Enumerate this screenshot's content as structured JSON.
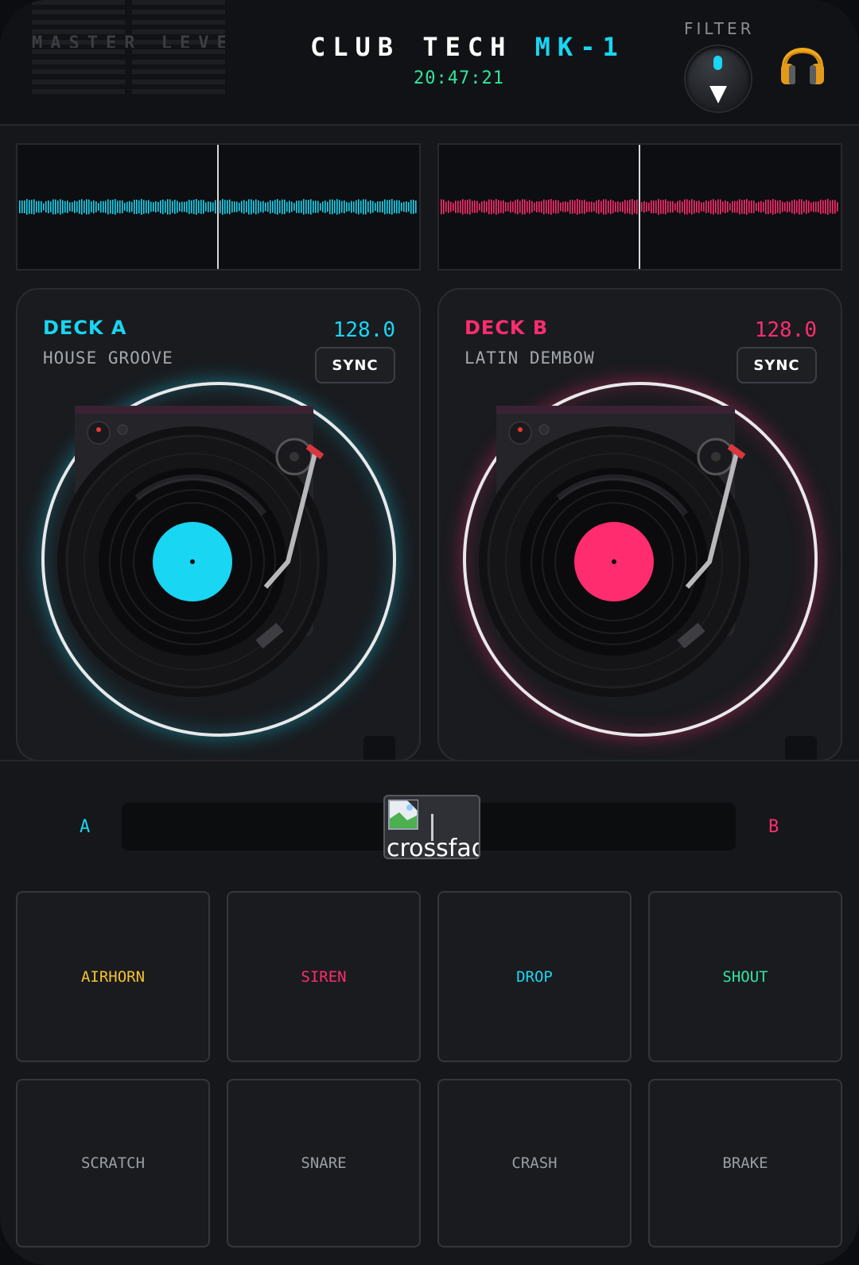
{
  "header": {
    "meter_label": "MASTER LEVEL",
    "title_main": "CLUB TECH",
    "title_model": "MK-1",
    "clock": "20:47:21",
    "filter_label": "FILTER"
  },
  "colors": {
    "deck_a_accent": "#19d6f2",
    "deck_b_accent": "#ff2d6f",
    "clock_green": "#2fe6a1",
    "airhorn": "#f5c22b",
    "siren": "#ff2d6f",
    "drop": "#19d6f2",
    "shout": "#2fe6a1"
  },
  "deck_a": {
    "name": "DECK A",
    "bpm": "128.0",
    "track": "HOUSE GROOVE",
    "sync_label": "SYNC"
  },
  "deck_b": {
    "name": "DECK B",
    "bpm": "128.0",
    "track": "LATIN DEMBOW",
    "sync_label": "SYNC"
  },
  "crossfader": {
    "label_a": "A",
    "label_b": "B",
    "handle_alt": "crossfader",
    "position": 0.5
  },
  "pads": {
    "row1": [
      "AIRHORN",
      "SIREN",
      "DROP",
      "SHOUT"
    ],
    "row2": [
      "SCRATCH",
      "SNARE",
      "CRASH",
      "BRAKE"
    ]
  },
  "icons": [
    "headphones-icon",
    "filter-knob",
    "turntable-icon",
    "broken-image-icon"
  ]
}
